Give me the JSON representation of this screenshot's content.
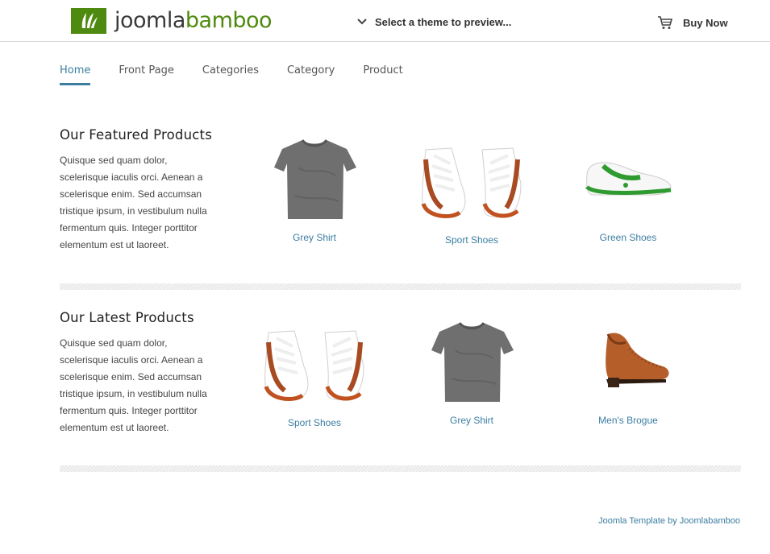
{
  "header": {
    "logo": {
      "text_dark": "joomla",
      "text_green": "bamboo"
    },
    "theme_select_label": "Select a theme to preview...",
    "buy_now_label": "Buy Now"
  },
  "menu": {
    "items": [
      {
        "label": "Home",
        "active": true
      },
      {
        "label": "Front Page"
      },
      {
        "label": "Categories"
      },
      {
        "label": "Category"
      },
      {
        "label": "Product"
      }
    ]
  },
  "featured": {
    "title": "Our Featured Products",
    "text": "Quisque sed quam dolor, scelerisque iaculis orci. Aenean a scelerisque enim. Sed accumsan tristique ipsum, in vestibulum nulla fermentum quis. Integer porttitor elementum est ut laoreet.",
    "products": [
      {
        "name": "Grey Shirt",
        "image": "grey-shirt"
      },
      {
        "name": "Sport Shoes",
        "image": "sport-shoes"
      },
      {
        "name": "Green Shoes",
        "image": "green-shoes"
      }
    ]
  },
  "latest": {
    "title": "Our Latest Products",
    "text": "Quisque sed quam dolor, scelerisque iaculis orci. Aenean a scelerisque enim. Sed accumsan tristique ipsum, in vestibulum nulla fermentum quis. Integer porttitor elementum est ut laoreet.",
    "products": [
      {
        "name": "Sport Shoes",
        "image": "sport-shoes"
      },
      {
        "name": "Grey Shirt",
        "image": "grey-shirt"
      },
      {
        "name": "Men's Brogue",
        "image": "mens-brogue"
      }
    ]
  },
  "footer": {
    "credit": "Joomla Template by Joomlabamboo"
  },
  "colors": {
    "accent": "#3b7ea1",
    "brand_green": "#4f8a10",
    "text": "#444444"
  }
}
